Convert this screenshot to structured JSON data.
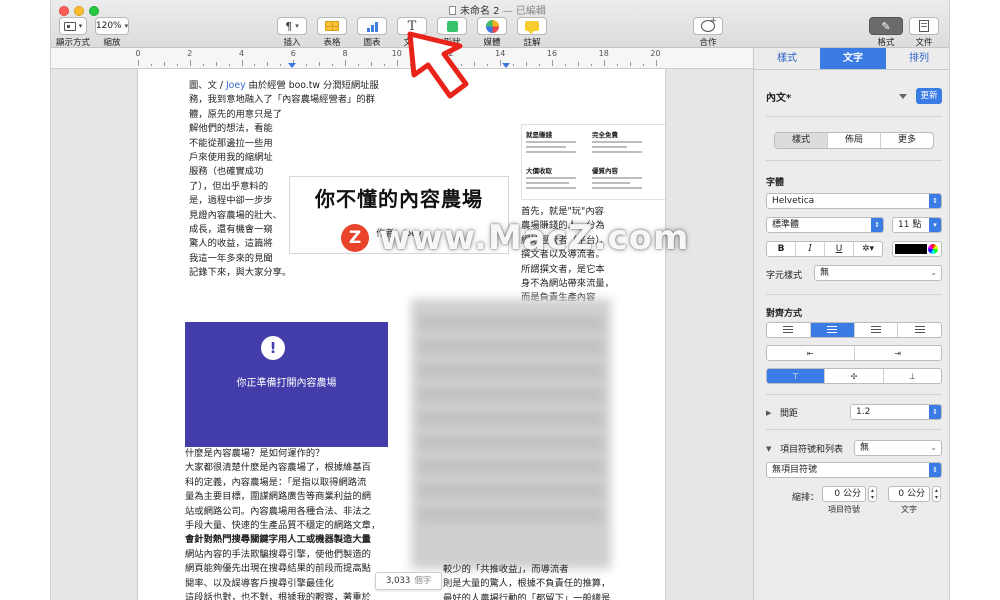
{
  "window": {
    "title": "未命名 2",
    "status": "— 已編輯"
  },
  "toolbar": {
    "view_label": "顯示方式",
    "zoom_value": "120%",
    "zoom_label": "縮放",
    "insert_label": "插入",
    "insert_glyph": "¶",
    "table_label": "表格",
    "chart_label": "圖表",
    "text_label": "文字",
    "text_glyph": "T",
    "shape_label": "形狀",
    "media_label": "媒體",
    "comment_label": "註解",
    "collaborate_label": "合作",
    "format_label": "格式",
    "document_label": "文件"
  },
  "ruler": {
    "numbers": [
      "0",
      "2",
      "4",
      "6",
      "8",
      "10",
      "12",
      "14",
      "16",
      "18",
      "20"
    ]
  },
  "doc": {
    "left_col": [
      "圖、文 / ",
      "Joey",
      " 由於經營 boo.tw 分潤短網址服",
      "務，我到意地融入了「內容農場經營者」的群",
      "體，原先的用意只是了",
      "解他們的想法，看能",
      "不能從那邊拉一些用",
      "戶來使用我的縮網址",
      "服務（也確實成功",
      "了），但出乎意料的",
      "是，過程中卻一步步",
      "見證內容農場的壯大、",
      "成長，還有機會一窺",
      "驚人的收益，這篇將",
      "我這一年多來的見聞",
      "記錄下來，與大家分享。"
    ],
    "title": "你不懂的內容農場",
    "author": "作者：Joey",
    "alert_text": "你正準備打開內容農場",
    "alert_glyph": "!",
    "right_col": [
      "首先，就是\"玩\"內容",
      "農場賺錢的人，分為",
      "網站經營者（平台）、",
      "撰文者以及導流者。",
      "所謂撰文者，是它本",
      "身不為網站帶來流量，",
      "而是負責生產內容"
    ],
    "bottom_text": [
      "什麼是內容農場？是如何運作的？",
      "大家都很清楚什麼是內容農場了，根據維基百",
      "科的定義，內容農場是：「是指以取得網路流",
      "量為主要目標，圍謀網路廣告等商業利益的網",
      "站或網路公司。內容農場用各種合法、非法之",
      "手段大量、快速的生產品質不穩定的網路文章，",
      "會針對熱門搜尋關鍵字用人工或機器製造大量",
      "網站內容的手法欺騙搜尋引擎，使他們製造的",
      "網頁能夠優先出現在搜尋結果的前段而提高點",
      "閱率、以及誤導客戶搜尋引擎最佳化",
      "這段話也對，也不對，根據我的觀察，著重於"
    ],
    "bottom_right": [
      "較少的「共推收益」，而導流者",
      "則是大量的驚人，根據不負責任的推算，",
      "最好的人農場行動的「都留下」一般總是"
    ],
    "thumb": {
      "cells": [
        {
          "head": "就是賺錢"
        },
        {
          "head": "完全免費"
        },
        {
          "head": "大價收取"
        },
        {
          "head": "優質內容"
        }
      ]
    },
    "word_count": "3,033",
    "word_unit": "個字"
  },
  "watermark": {
    "badge": "Z",
    "text": "www.MacZ.com"
  },
  "sidebar": {
    "tabs": [
      "樣式",
      "文字",
      "排列"
    ],
    "paragraph_style": "內文*",
    "update_label": "更新",
    "subtabs": [
      "樣式",
      "佈局",
      "更多"
    ],
    "font_heading": "字體",
    "font_family": "Helvetica",
    "font_weight": "標準體",
    "font_size": "11 點",
    "bold": "B",
    "italic": "I",
    "underline": "U",
    "char_style_label": "字元樣式",
    "char_style_value": "無",
    "alignment_heading": "對齊方式",
    "spacing_label": "間距",
    "spacing_value": "1.2",
    "bullets_label": "項目符號和列表",
    "bullets_value": "無",
    "bullet_type": "無項目符號",
    "indent_label": "縮排：",
    "indent_bullet_value": "0 公分",
    "indent_text_value": "0 公分",
    "indent_bullet_caption": "項目符號",
    "indent_text_caption": "文字"
  },
  "colors": {
    "accent": "#3a7ce4",
    "alert_card": "#423da8",
    "arrow": "#e8231a",
    "link": "#3a6ac9"
  }
}
